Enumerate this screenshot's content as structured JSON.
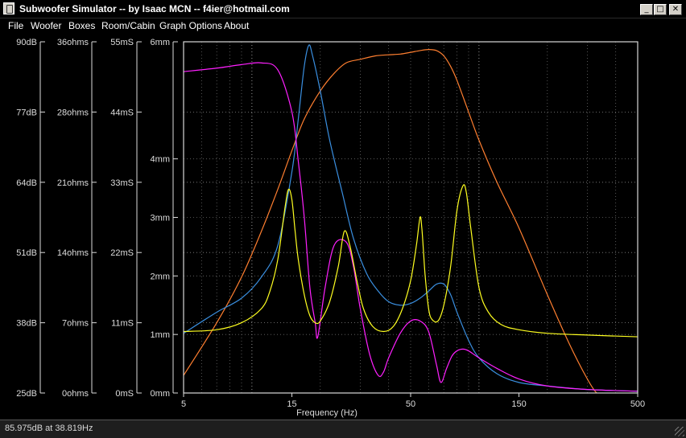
{
  "window": {
    "title": "Subwoofer Simulator -- by Isaac MCN -- f4ier@hotmail.com",
    "minimize_glyph": "_",
    "maximize_glyph": "□",
    "close_glyph": "✕"
  },
  "menu": [
    "File",
    "Woofer",
    "Boxes",
    "Room/Cabin",
    "Graph Options",
    "About"
  ],
  "axes": {
    "db": [
      "90dB",
      "77dB",
      "64dB",
      "51dB",
      "38dB",
      "25dB"
    ],
    "ohms": [
      "36ohms",
      "28ohms",
      "21ohms",
      "14ohms",
      "7ohms",
      "0ohms"
    ],
    "ms": [
      "55mS",
      "44mS",
      "33mS",
      "22mS",
      "11mS",
      "0mS"
    ],
    "mm": [
      "6mm",
      "4mm",
      "3mm",
      "2mm",
      "1mm",
      "0mm"
    ],
    "mm_values": [
      6,
      4,
      3,
      2,
      1,
      0
    ],
    "x_ticks": [
      "5",
      "15",
      "50",
      "150",
      "500"
    ],
    "x_values": [
      5,
      15,
      50,
      150,
      500
    ],
    "x_label": "Frequency (Hz)"
  },
  "chart_data": {
    "type": "line",
    "x_scale": "log",
    "xlim": [
      5,
      500
    ],
    "ylim": [
      0,
      1
    ],
    "xlabel": "Frequency (Hz)",
    "grid": true,
    "series": [
      {
        "color": "#ff7f30",
        "x": [
          5,
          7,
          9,
          11,
          13,
          15,
          17,
          20,
          23,
          26,
          30,
          35,
          40,
          45,
          50,
          55,
          60,
          65,
          70,
          75,
          80,
          90,
          100,
          120,
          150,
          200,
          250,
          300,
          330,
          350
        ],
        "y": [
          0.05,
          0.2,
          0.33,
          0.46,
          0.58,
          0.69,
          0.78,
          0.86,
          0.91,
          0.94,
          0.95,
          0.96,
          0.963,
          0.965,
          0.97,
          0.975,
          0.978,
          0.975,
          0.96,
          0.93,
          0.89,
          0.8,
          0.72,
          0.6,
          0.47,
          0.28,
          0.14,
          0.04,
          0.0,
          0.0
        ]
      },
      {
        "color": "#3a8fe0",
        "x": [
          5,
          7,
          9,
          11,
          13,
          15,
          16,
          17,
          17.8,
          18.5,
          20,
          22,
          25,
          28,
          32,
          36,
          40,
          45,
          50,
          55,
          60,
          65,
          70,
          75,
          80,
          90,
          100,
          120,
          150,
          200,
          300,
          500
        ],
        "y": [
          0.17,
          0.23,
          0.27,
          0.33,
          0.42,
          0.63,
          0.78,
          0.93,
          0.99,
          0.96,
          0.86,
          0.72,
          0.57,
          0.44,
          0.34,
          0.29,
          0.26,
          0.25,
          0.255,
          0.27,
          0.29,
          0.31,
          0.31,
          0.28,
          0.23,
          0.15,
          0.1,
          0.055,
          0.03,
          0.02,
          0.01,
          0.005
        ]
      },
      {
        "color": "#ff20ff",
        "x": [
          5,
          7,
          9,
          11,
          13,
          15,
          16,
          17,
          18,
          19,
          19.5,
          21,
          23,
          26,
          28,
          30,
          33,
          36,
          38,
          40,
          45,
          50,
          55,
          60,
          65,
          68,
          72,
          76,
          80,
          85,
          90,
          100,
          120,
          150,
          200,
          300,
          500
        ],
        "y": [
          0.915,
          0.925,
          0.935,
          0.94,
          0.92,
          0.8,
          0.66,
          0.5,
          0.3,
          0.2,
          0.16,
          0.3,
          0.42,
          0.43,
          0.36,
          0.24,
          0.11,
          0.05,
          0.06,
          0.1,
          0.17,
          0.205,
          0.205,
          0.175,
          0.08,
          0.03,
          0.07,
          0.105,
          0.12,
          0.125,
          0.12,
          0.1,
          0.07,
          0.04,
          0.02,
          0.01,
          0.005
        ]
      },
      {
        "color": "#ffff20",
        "x": [
          5,
          7,
          9,
          11,
          12,
          13,
          14,
          14.5,
          15,
          15.5,
          16,
          17,
          18,
          19,
          20,
          22,
          24,
          25.5,
          27,
          29,
          31,
          34,
          38,
          42,
          46,
          50,
          53,
          55,
          56,
          57,
          58,
          60,
          62,
          66,
          70,
          75,
          80,
          85,
          88,
          92,
          100,
          110,
          125,
          150,
          200,
          300,
          500
        ],
        "y": [
          0.175,
          0.18,
          0.2,
          0.24,
          0.29,
          0.38,
          0.53,
          0.58,
          0.55,
          0.46,
          0.38,
          0.28,
          0.22,
          0.2,
          0.205,
          0.26,
          0.36,
          0.46,
          0.42,
          0.32,
          0.24,
          0.19,
          0.175,
          0.19,
          0.24,
          0.32,
          0.42,
          0.5,
          0.47,
          0.4,
          0.33,
          0.24,
          0.21,
          0.205,
          0.25,
          0.36,
          0.52,
          0.59,
          0.57,
          0.47,
          0.3,
          0.23,
          0.195,
          0.18,
          0.17,
          0.165,
          0.16
        ]
      }
    ]
  },
  "status": {
    "text": "85.975dB at 38.819Hz"
  }
}
